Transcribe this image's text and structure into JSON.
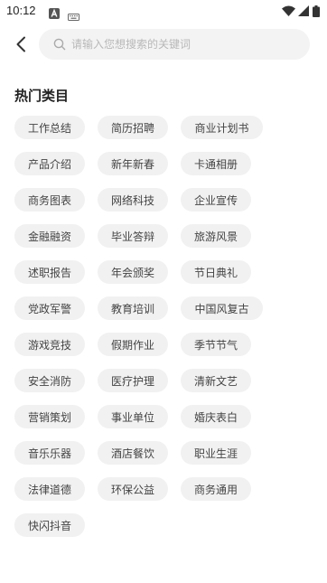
{
  "status_bar": {
    "time": "10:12",
    "icons": [
      "a-notification-icon",
      "keyboard-icon",
      "wifi-icon",
      "signal-icon",
      "battery-icon"
    ]
  },
  "header": {
    "back_icon": "chevron-left-icon",
    "search": {
      "placeholder": "请输入您想搜索的关键词",
      "value": "",
      "icon": "search-icon"
    }
  },
  "hot_categories": {
    "title": "热门类目",
    "tags": [
      "工作总结",
      "简历招聘",
      "商业计划书",
      "产品介绍",
      "新年新春",
      "卡通相册",
      "商务图表",
      "网络科技",
      "企业宣传",
      "金融融资",
      "毕业答辩",
      "旅游风景",
      "述职报告",
      "年会颁奖",
      "节日典礼",
      "党政军警",
      "教育培训",
      "中国风复古",
      "游戏竞技",
      "假期作业",
      "季节节气",
      "安全消防",
      "医疗护理",
      "清新文艺",
      "营销策划",
      "事业单位",
      "婚庆表白",
      "音乐乐器",
      "酒店餐饮",
      "职业生涯",
      "法律道德",
      "环保公益",
      "商务通用",
      "快闪抖音"
    ]
  },
  "colors": {
    "tag_background": "#f1f1f1",
    "search_background": "#f3f3f3",
    "placeholder": "#b8b8b8",
    "title_text": "#222222"
  }
}
